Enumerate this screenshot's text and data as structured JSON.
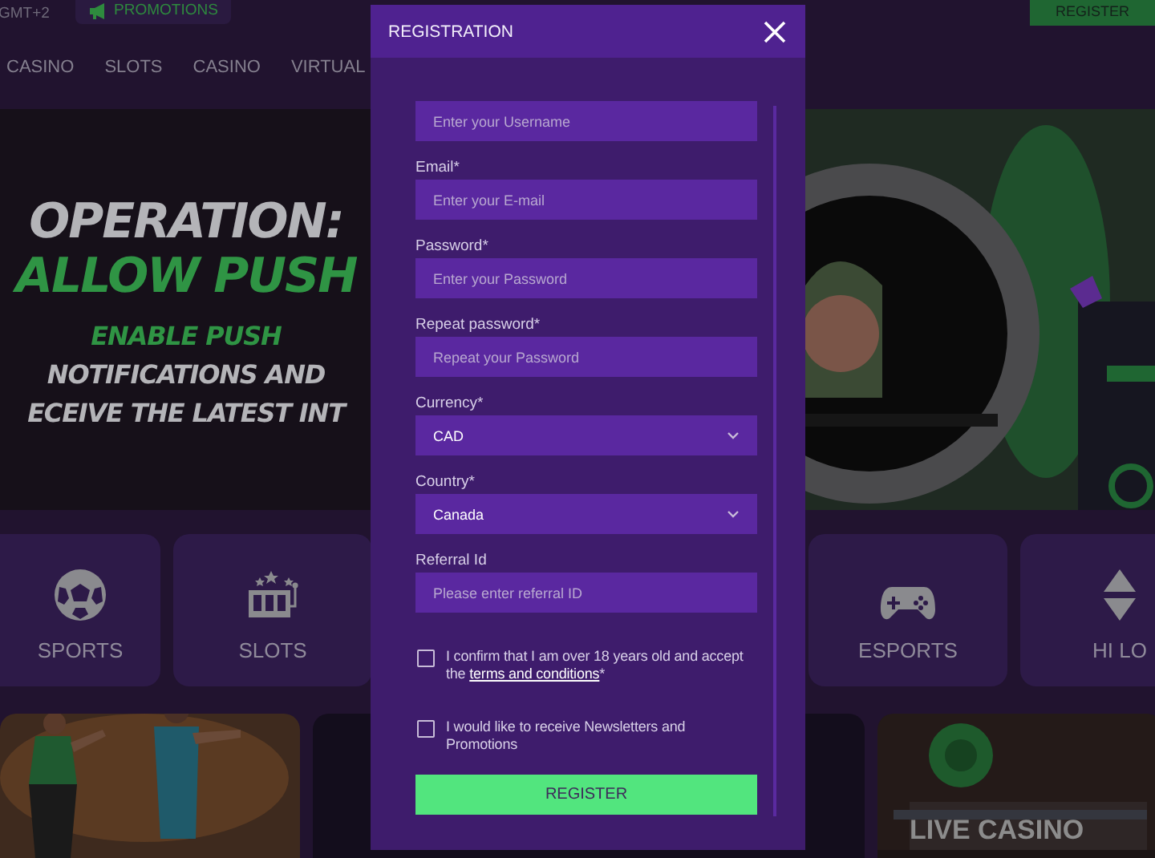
{
  "top_bar": {
    "timezone": "GMT+2",
    "promotions": "PROMOTIONS",
    "register": "REGISTER"
  },
  "nav": [
    "CASINO",
    "SLOTS",
    "CASINO",
    "VIRTUAL"
  ],
  "banner": {
    "lines": [
      {
        "text": "OPERATION:",
        "kind": "headline",
        "color": "#b4b4b8"
      },
      {
        "text": "ALLOW PUSH",
        "kind": "headline",
        "color": "#2f9444"
      },
      {
        "text": "ENABLE PUSH",
        "kind": "subline",
        "color": "#2f9444"
      },
      {
        "text": "NOTIFICATIONS AND",
        "kind": "subline",
        "color": "#b4b4b8"
      },
      {
        "text": "ECEIVE THE LATEST INT",
        "kind": "subline",
        "color": "#b4b4b8"
      }
    ]
  },
  "categories": [
    {
      "label": "SPORTS",
      "kind": "ball"
    },
    {
      "label": "SLOTS",
      "kind": "slots"
    },
    {
      "kind": "hidden"
    },
    {
      "kind": "hidden"
    },
    {
      "label": "ESPORTS",
      "kind": "gamepad"
    },
    {
      "label": "HI LO",
      "kind": "hilo"
    }
  ],
  "cards": [
    {
      "kind": "picture"
    },
    {
      "kind": "dark"
    },
    {
      "kind": "picture",
      "title": "LIVE CASINO"
    }
  ],
  "dialog": {
    "title": "REGISTRATION",
    "fields": [
      {
        "kind": "text",
        "placeholder": "Enter your Username"
      },
      {
        "kind": "text",
        "label": "Email*",
        "placeholder": "Enter your E-mail"
      },
      {
        "kind": "text",
        "label": "Password*",
        "placeholder": "Enter your Password"
      },
      {
        "kind": "text",
        "label": "Repeat password*",
        "placeholder": "Repeat your Password"
      },
      {
        "kind": "select",
        "label": "Currency*",
        "value": "CAD"
      },
      {
        "kind": "select",
        "label": "Country*",
        "value": "Canada"
      },
      {
        "kind": "text",
        "label": "Referral Id",
        "placeholder": "Please enter referral ID"
      }
    ],
    "checkboxes": [
      {
        "text": "I confirm that I am over 18 years old and accept the ",
        "link": "terms and conditions",
        "suffix": "*",
        "checked": false
      },
      {
        "text": "I would like to receive Newsletters and Promotions",
        "checked": false
      }
    ],
    "submit": "REGISTER"
  }
}
